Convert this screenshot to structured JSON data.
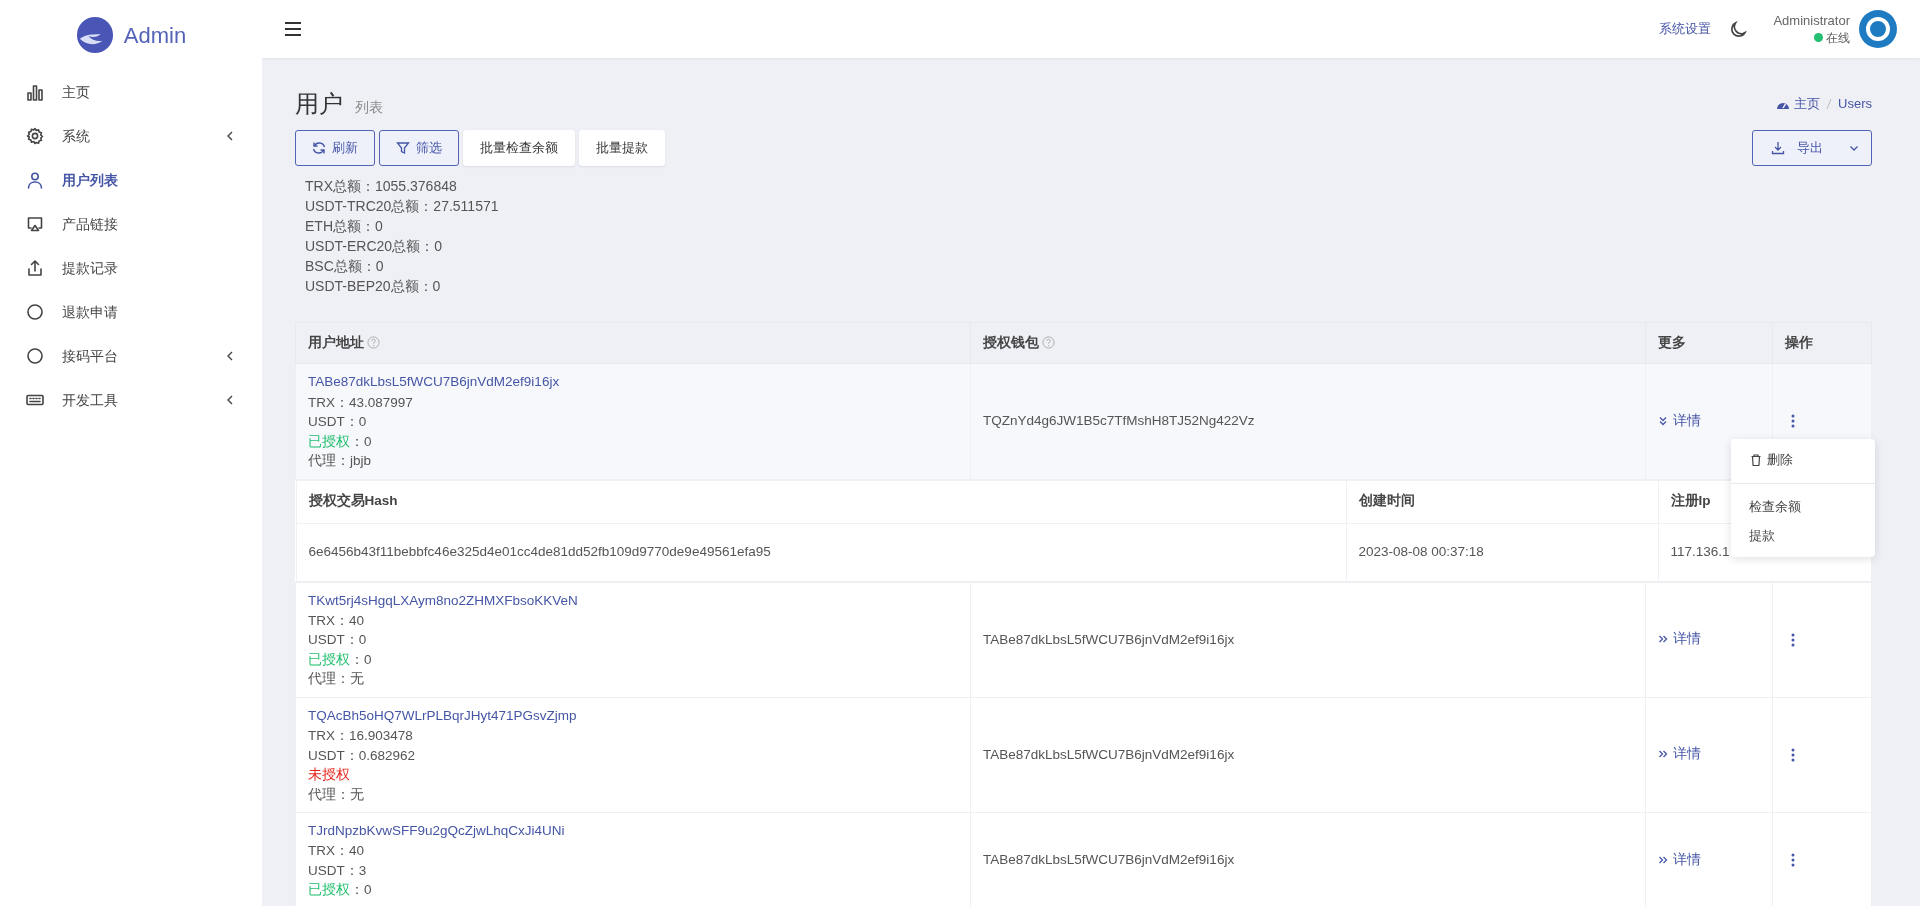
{
  "sidebar": {
    "logo_text": "Admin",
    "items": [
      {
        "label": "主页",
        "kind": "chart",
        "selected": false,
        "has_submenu": false
      },
      {
        "label": "系统",
        "kind": "gear",
        "selected": false,
        "has_submenu": true
      },
      {
        "label": "用户列表",
        "kind": "user",
        "selected": true,
        "has_submenu": false
      },
      {
        "label": "产品链接",
        "kind": "monitor",
        "selected": false,
        "has_submenu": false
      },
      {
        "label": "提款记录",
        "kind": "upload",
        "selected": false,
        "has_submenu": false
      },
      {
        "label": "退款申请",
        "kind": "circle",
        "selected": false,
        "has_submenu": false
      },
      {
        "label": "接码平台",
        "kind": "circle",
        "selected": false,
        "has_submenu": true
      },
      {
        "label": "开发工具",
        "kind": "keyboard",
        "selected": false,
        "has_submenu": true
      }
    ]
  },
  "header": {
    "settings_link": "系统设置",
    "user_name": "Administrator",
    "status": "在线"
  },
  "page": {
    "title": "用户",
    "subtitle": "列表",
    "breadcrumb": [
      "主页",
      "Users"
    ]
  },
  "toolbar": [
    {
      "label": "刷新",
      "kind": "refresh"
    },
    {
      "label": "筛选",
      "kind": "filter"
    },
    {
      "label": "批量检查余额",
      "kind": "plain"
    },
    {
      "label": "批量提款",
      "kind": "plain"
    }
  ],
  "export_button": "导出",
  "totals": [
    "TRX总额：1055.376848",
    "USDT-TRC20总额：27.511571",
    "ETH总额：0",
    "USDT-ERC20总额：0",
    "BSC总额：0",
    "USDT-BEP20总额：0"
  ],
  "table": {
    "columns": [
      {
        "label": "用户地址",
        "help": true
      },
      {
        "label": "授权钱包",
        "help": true
      },
      {
        "label": "更多",
        "help": false
      },
      {
        "label": "操作",
        "help": false
      }
    ],
    "rows": [
      {
        "address": "TABe87dkLbsL5fWCU7B6jnVdM2ef9i16jx",
        "trx": "TRX：43.087997",
        "usdt": "USDT：0",
        "authorized": true,
        "auth_label": "已授权",
        "auth_rest": "：0",
        "agent": "代理：jbjb",
        "wallet": "TQZnYd4g6JW1B5c7TfMshH8TJ52Ng422Vz",
        "more": "详情",
        "expanded": true,
        "detail": {
          "columns": [
            "授权交易Hash",
            "创建时间",
            "注册Ip"
          ],
          "values": [
            "6e6456b43f11bebbfc46e325d4e01cc4de81dd52fb109d9770de9e49561efa95",
            "2023-08-08 00:37:18",
            "117.136.1"
          ]
        }
      },
      {
        "address": "TKwt5rj4sHgqLXAym8no2ZHMXFbsoKKVeN",
        "trx": "TRX：40",
        "usdt": "USDT：0",
        "authorized": true,
        "auth_label": "已授权",
        "auth_rest": "：0",
        "agent": "代理：无",
        "wallet": "TABe87dkLbsL5fWCU7B6jnVdM2ef9i16jx",
        "more": "详情",
        "expanded": false
      },
      {
        "address": "TQAcBh5oHQ7WLrPLBqrJHyt471PGsvZjmp",
        "trx": "TRX：16.903478",
        "usdt": "USDT：0.682962",
        "authorized": false,
        "auth_label": "未授权",
        "agent": "代理：无",
        "wallet": "TABe87dkLbsL5fWCU7B6jnVdM2ef9i16jx",
        "more": "详情",
        "expanded": false
      },
      {
        "address": "TJrdNpzbKvwSFF9u2gQcZjwLhqCxJi4UNi",
        "trx": "TRX：40",
        "usdt": "USDT：3",
        "authorized": true,
        "auth_label": "已授权",
        "auth_rest": "：0",
        "wallet": "TABe87dkLbsL5fWCU7B6jnVdM2ef9i16jx",
        "more": "详情",
        "expanded": false
      }
    ]
  },
  "action_menu": [
    {
      "kind": "delete",
      "label": "删除"
    },
    {
      "kind": "divider"
    },
    {
      "kind": "item",
      "label": "检查余额"
    },
    {
      "kind": "item",
      "label": "提款"
    }
  ]
}
